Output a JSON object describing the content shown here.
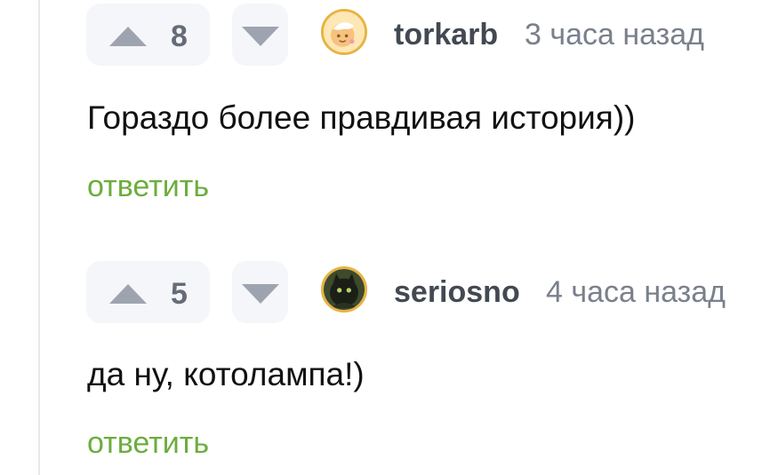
{
  "comments": [
    {
      "rating": "8",
      "username": "torkarb",
      "time": "3 часа назад",
      "text": "Гораздо более правдивая история))",
      "reply_label": "ответить",
      "avatar_icon": "cake-avatar-icon"
    },
    {
      "rating": "5",
      "username": "seriosno",
      "time": "4 часа назад",
      "text": "да ну, котолампа!)",
      "reply_label": "ответить",
      "avatar_icon": "black-cat-avatar-icon"
    }
  ],
  "colors": {
    "reply_link": "#6cad3d",
    "avatar_border": "#e8b341",
    "vote_bg": "#f5f6f9",
    "vote_arrow": "#9ea4af"
  }
}
